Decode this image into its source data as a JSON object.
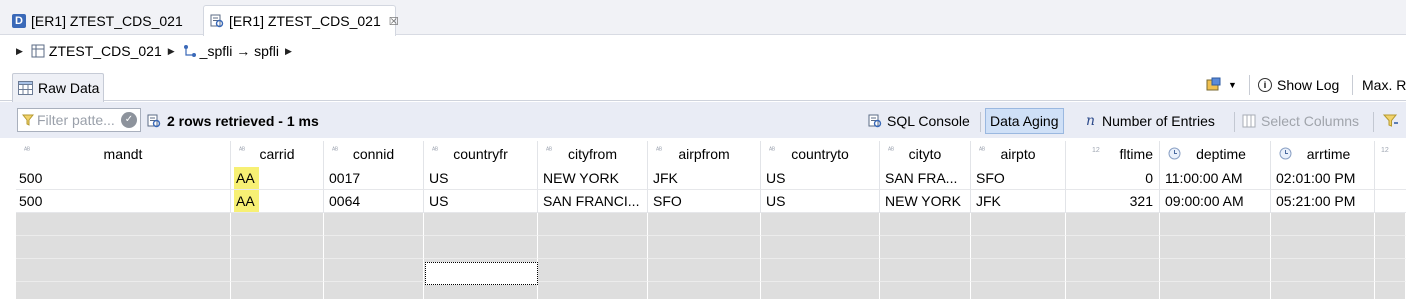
{
  "editor_tabs": [
    {
      "label": "[ER1] ZTEST_CDS_021",
      "icon": "ddl-d-icon"
    },
    {
      "label": "[ER1] ZTEST_CDS_021",
      "icon": "data-preview-icon",
      "close": "☒"
    }
  ],
  "breadcrumb": {
    "entity": "ZTEST_CDS_021",
    "association": "_spfli → spfli"
  },
  "view_tab": {
    "label": "Raw Data"
  },
  "view_actions": {
    "show_log": "Show Log",
    "max": "Max. R"
  },
  "toolbar": {
    "filter_placeholder": "Filter patte...",
    "status": "2 rows retrieved - 1 ms",
    "sql_console": "SQL Console",
    "data_aging": "Data Aging",
    "number_of_entries": "Number of Entries",
    "select_columns": "Select Columns"
  },
  "table": {
    "columns": [
      "mandt",
      "carrid",
      "connid",
      "countryfr",
      "cityfrom",
      "airpfrom",
      "countryto",
      "cityto",
      "airpto",
      "fltime",
      "deptime",
      "arrtime"
    ],
    "rows": [
      [
        "500",
        "AA",
        "0017",
        "US",
        "NEW YORK",
        "JFK",
        "US",
        "SAN FRA...",
        "SFO",
        "0",
        "11:00:00 AM",
        "02:01:00 PM"
      ],
      [
        "500",
        "AA",
        "0064",
        "US",
        "SAN FRANCI...",
        "SFO",
        "US",
        "NEW YORK",
        "JFK",
        "321",
        "09:00:00 AM",
        "05:21:00 PM"
      ]
    ],
    "type_markers": {
      "text": "ᴬᴮ",
      "number": "12"
    },
    "highlight_color": "#f7f074"
  }
}
